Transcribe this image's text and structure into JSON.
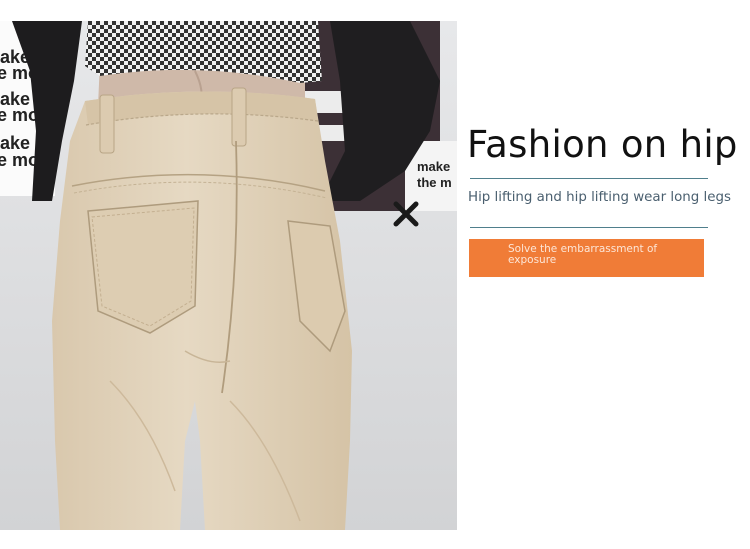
{
  "photo": {
    "wall_text_left": [
      "ake",
      "e mo",
      "ake",
      "e mo",
      "ake",
      "e mo"
    ],
    "wall_text_right": [
      "make",
      "the m"
    ]
  },
  "copy": {
    "headline": "Fashion on hip",
    "subline": "Hip lifting and hip lifting wear long legs",
    "badge": "Solve the embarrassment of exposure"
  },
  "colors": {
    "rule": "#4f7f8c",
    "badge": "#f07c37",
    "headline": "#111111",
    "subline": "#4a5f6f",
    "pants": "#e2d4bd"
  }
}
